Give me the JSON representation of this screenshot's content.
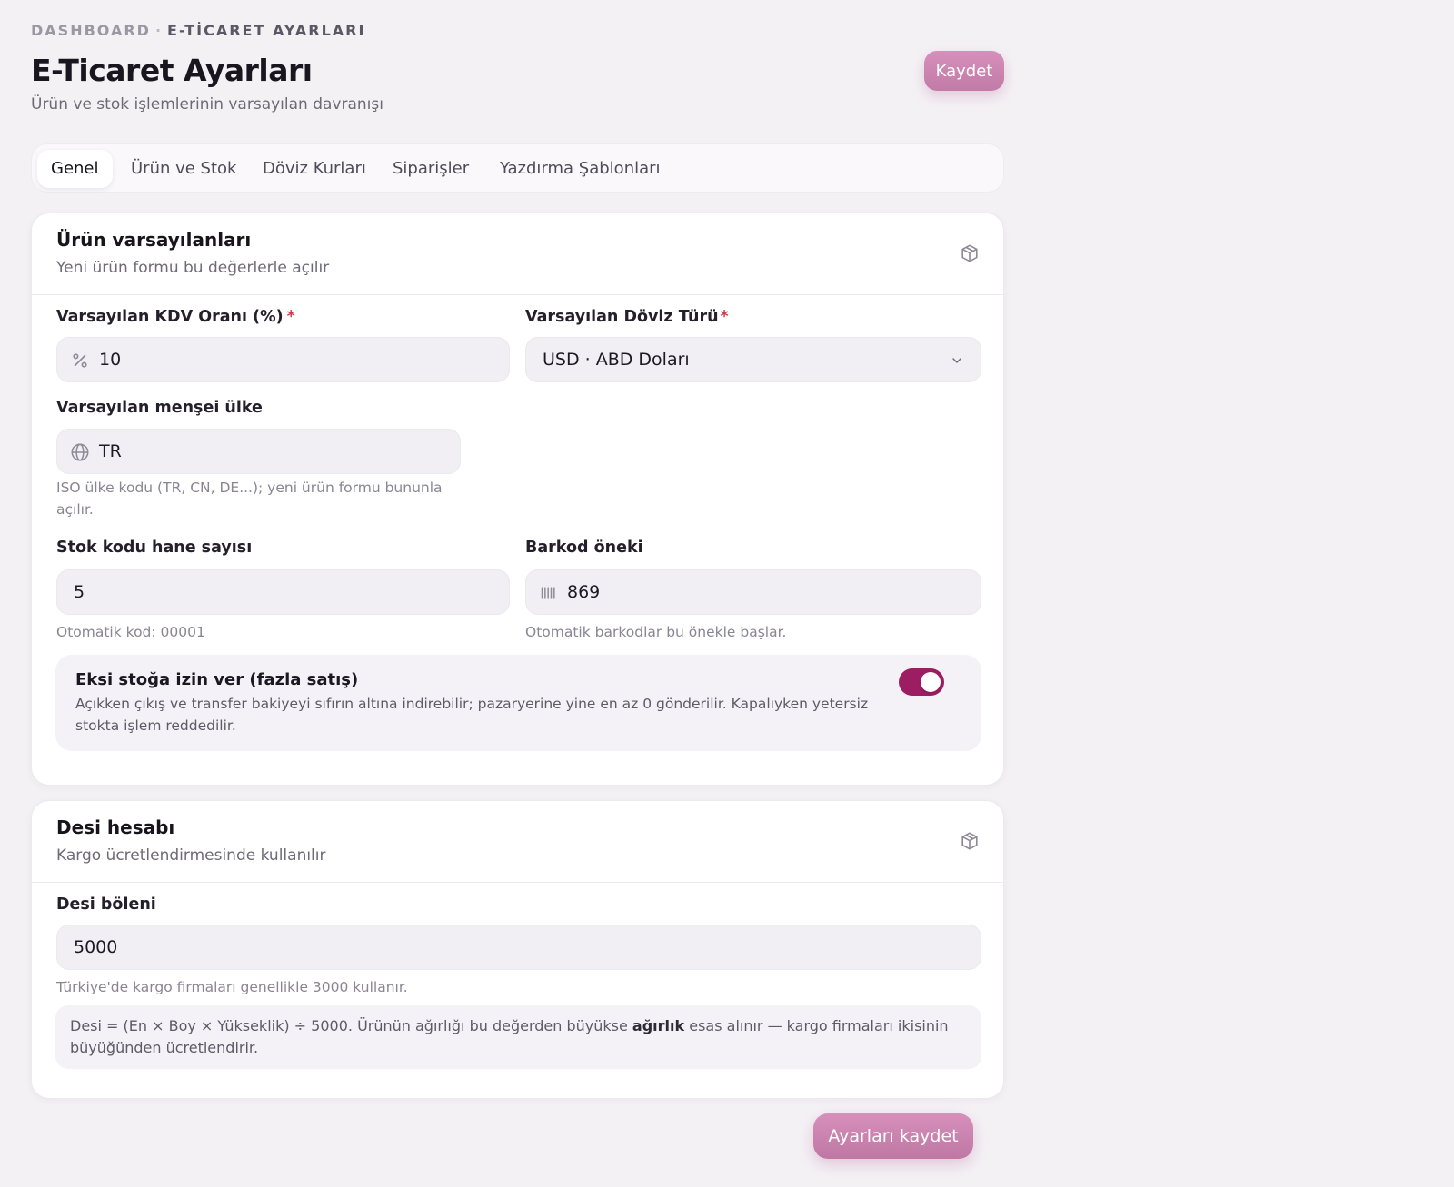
{
  "breadcrumb": {
    "items": [
      "DASHBOARD",
      "E-TİCARET AYARLARI"
    ],
    "separator": "·"
  },
  "header": {
    "title": "E-Ticaret Ayarları",
    "subtitle": "Ürün ve stok işlemlerinin varsayılan davranışı",
    "save_label": "Kaydet"
  },
  "tabs": [
    {
      "label": "Genel",
      "active": true
    },
    {
      "label": "Ürün ve Stok",
      "active": false
    },
    {
      "label": "Döviz Kurları",
      "active": false
    },
    {
      "label": "Siparişler",
      "active": false
    },
    {
      "label": "Yazdırma Şablonları",
      "active": false
    }
  ],
  "product_defaults": {
    "title": "Ürün varsayılanları",
    "subtitle": "Yeni ürün formu bu değerlerle açılır",
    "icon": "box-icon",
    "vat": {
      "label": "Varsayılan KDV Oranı (%)",
      "required_mark": "*",
      "value": "10",
      "icon": "percent-icon"
    },
    "currency": {
      "label": "Varsayılan Döviz Türü",
      "required_mark": "*",
      "value": "USD · ABD Doları",
      "icon": "chevron-down-icon"
    },
    "origin": {
      "label": "Varsayılan menşei ülke",
      "value": "TR",
      "icon": "globe-icon",
      "hint": "ISO ülke kodu (TR, CN, DE...); yeni ürün formu bununla açılır."
    },
    "stock_digits": {
      "label": "Stok kodu hane sayısı",
      "value": "5",
      "hint": "Otomatik kod: 00001"
    },
    "barcode_prefix": {
      "label": "Barkod öneki",
      "value": "869",
      "icon": "barcode-icon",
      "hint": "Otomatik barkodlar bu önekle başlar."
    },
    "negative_stock": {
      "title": "Eksi stoğa izin ver (fazla satış)",
      "description": "Açıkken çıkış ve transfer bakiyeyi sıfırın altına indirebilir; pazaryerine yine en az 0 gönderilir. Kapalıyken yetersiz stokta işlem reddedilir.",
      "enabled": true
    }
  },
  "desi": {
    "title": "Desi hesabı",
    "subtitle": "Kargo ücretlendirmesinde kullanılır",
    "icon": "box-icon",
    "divisor": {
      "label": "Desi böleni",
      "value": "5000",
      "hint": "Türkiye'de kargo firmaları genellikle 3000 kullanır."
    },
    "info": {
      "before": "Desi = (En × Boy × Yükseklik) ÷ 5000. Ürünün ağırlığı bu değerden büyükse ",
      "bold": "ağırlık",
      "after": " esas alınır — kargo firmaları ikisinin büyüğünden ücretlendirir."
    }
  },
  "footer": {
    "save_label": "Ayarları kaydet"
  },
  "colors": {
    "accent": "#9c1d62",
    "button": "#cf89b5",
    "required": "#d23a4c"
  }
}
